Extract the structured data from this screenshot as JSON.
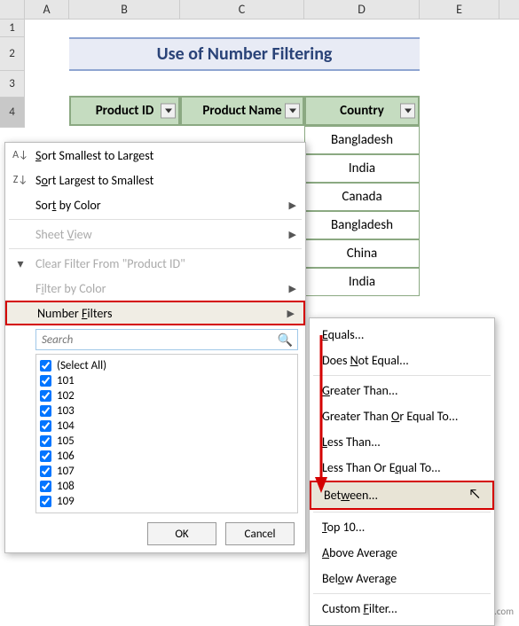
{
  "columns": [
    "A",
    "B",
    "C",
    "D",
    "E"
  ],
  "rows": [
    "1",
    "2",
    "3",
    "4"
  ],
  "title": "Use of Number Filtering",
  "headers": {
    "b": "Product ID",
    "c": "Product Name",
    "d": "Country"
  },
  "data_country": [
    "Bangladesh",
    "India",
    "Canada",
    "Bangladesh",
    "China",
    "India"
  ],
  "menu": {
    "sort_asc": "Sort Smallest to Largest",
    "sort_desc": "Sort Largest to Smallest",
    "sort_color": "Sort by Color",
    "sheet_view": "Sheet View",
    "clear": "Clear Filter From \"Product ID\"",
    "filter_color": "Filter by Color",
    "number_filters": "Number Filters",
    "search_ph": "Search",
    "select_all": "(Select All)",
    "items": [
      "101",
      "102",
      "103",
      "104",
      "105",
      "106",
      "107",
      "108",
      "109"
    ],
    "ok": "OK",
    "cancel": "Cancel"
  },
  "submenu": {
    "equals": "Equals...",
    "not_equal": "Does Not Equal...",
    "gt": "Greater Than...",
    "gte": "Greater Than Or Equal To...",
    "lt": "Less Than...",
    "lte": "Less Than Or Equal To...",
    "between": "Between...",
    "top10": "Top 10...",
    "above_avg": "Above Average",
    "below_avg": "Below Average",
    "custom": "Custom Filter..."
  },
  "watermark": "wsxdn.com",
  "chart_data": {
    "type": "table",
    "title": "Use of Number Filtering",
    "columns": [
      "Product ID",
      "Product Name",
      "Country"
    ],
    "filter_values": [
      101,
      102,
      103,
      104,
      105,
      106,
      107,
      108,
      109
    ],
    "country_rows": [
      "Bangladesh",
      "India",
      "Canada",
      "Bangladesh",
      "China",
      "India"
    ]
  }
}
